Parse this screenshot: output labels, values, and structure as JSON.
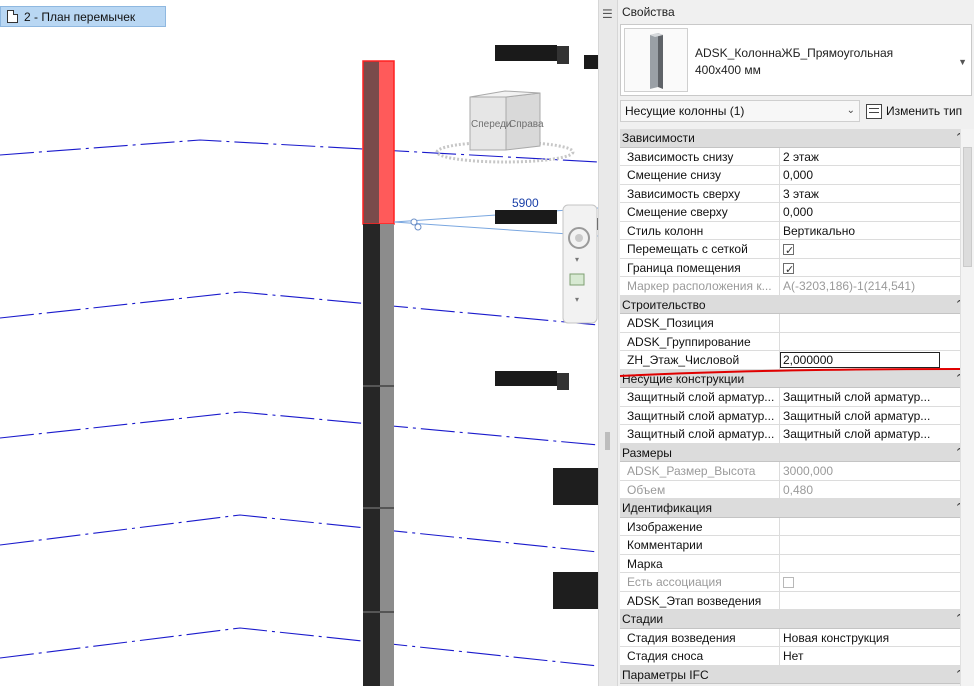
{
  "view": {
    "tab_title": "2 - План перемычек",
    "dimension_value": "5900",
    "viewcube": {
      "front_label": "Спереди",
      "right_label": "Справа"
    }
  },
  "properties": {
    "title": "Свойства",
    "type_name_line1": "ADSK_КолоннаЖБ_Прямоугольная",
    "type_name_line2": "400x400 мм",
    "category_selector": "Несущие колонны (1)",
    "edit_type_label": "Изменить тип",
    "groups": [
      {
        "name": "Зависимости",
        "rows": [
          {
            "label": "Зависимость снизу",
            "value": "2 этаж"
          },
          {
            "label": "Смещение снизу",
            "value": "0,000",
            "side": true
          },
          {
            "label": "Зависимость сверху",
            "value": "3 этаж"
          },
          {
            "label": "Смещение сверху",
            "value": "0,000",
            "side": true
          },
          {
            "label": "Стиль колонн",
            "value": "Вертикально"
          },
          {
            "label": "Перемещать с сеткой",
            "checkbox": "checked"
          },
          {
            "label": "Граница помещения",
            "checkbox": "checked"
          },
          {
            "label": "Маркер расположения к...",
            "value": "A(-3203,186)-1(214,541)",
            "disabled": true
          }
        ]
      },
      {
        "name": "Строительство",
        "rows": [
          {
            "label": "ADSK_Позиция",
            "value": "",
            "side": true
          },
          {
            "label": "ADSK_Группирование",
            "value": "",
            "side": true
          },
          {
            "label": "ZH_Этаж_Числовой",
            "value": "2,000000",
            "editing": true,
            "side": true
          }
        ]
      },
      {
        "name": "Несущие конструкции",
        "rows": [
          {
            "label": "Защитный слой арматур...",
            "value": "Защитный слой арматур..."
          },
          {
            "label": "Защитный слой арматур...",
            "value": "Защитный слой арматур..."
          },
          {
            "label": "Защитный слой арматур...",
            "value": "Защитный слой арматур..."
          }
        ]
      },
      {
        "name": "Размеры",
        "rows": [
          {
            "label": "ADSK_Размер_Высота",
            "value": "3000,000",
            "disabled": true
          },
          {
            "label": "Объем",
            "value": "0,480",
            "disabled": true
          }
        ]
      },
      {
        "name": "Идентификация",
        "rows": [
          {
            "label": "Изображение",
            "value": ""
          },
          {
            "label": "Комментарии",
            "value": "",
            "side": true
          },
          {
            "label": "Марка",
            "value": ""
          },
          {
            "label": "Есть ассоциация",
            "checkbox": "disabled",
            "disabled": true
          },
          {
            "label": "ADSK_Этап возведения",
            "value": "",
            "side": true
          }
        ]
      },
      {
        "name": "Стадии",
        "rows": [
          {
            "label": "Стадия возведения",
            "value": "Новая конструкция"
          },
          {
            "label": "Стадия сноса",
            "value": "Нет"
          }
        ]
      },
      {
        "name": "Параметры IFC",
        "rows": []
      }
    ]
  },
  "colors": {
    "grid_line": "#1a1acc",
    "column_selected": "#ff3b3b",
    "column_dark": "#2a2a2a",
    "annotation_red": "#e00000",
    "tab_bg": "#b9d7f3"
  }
}
